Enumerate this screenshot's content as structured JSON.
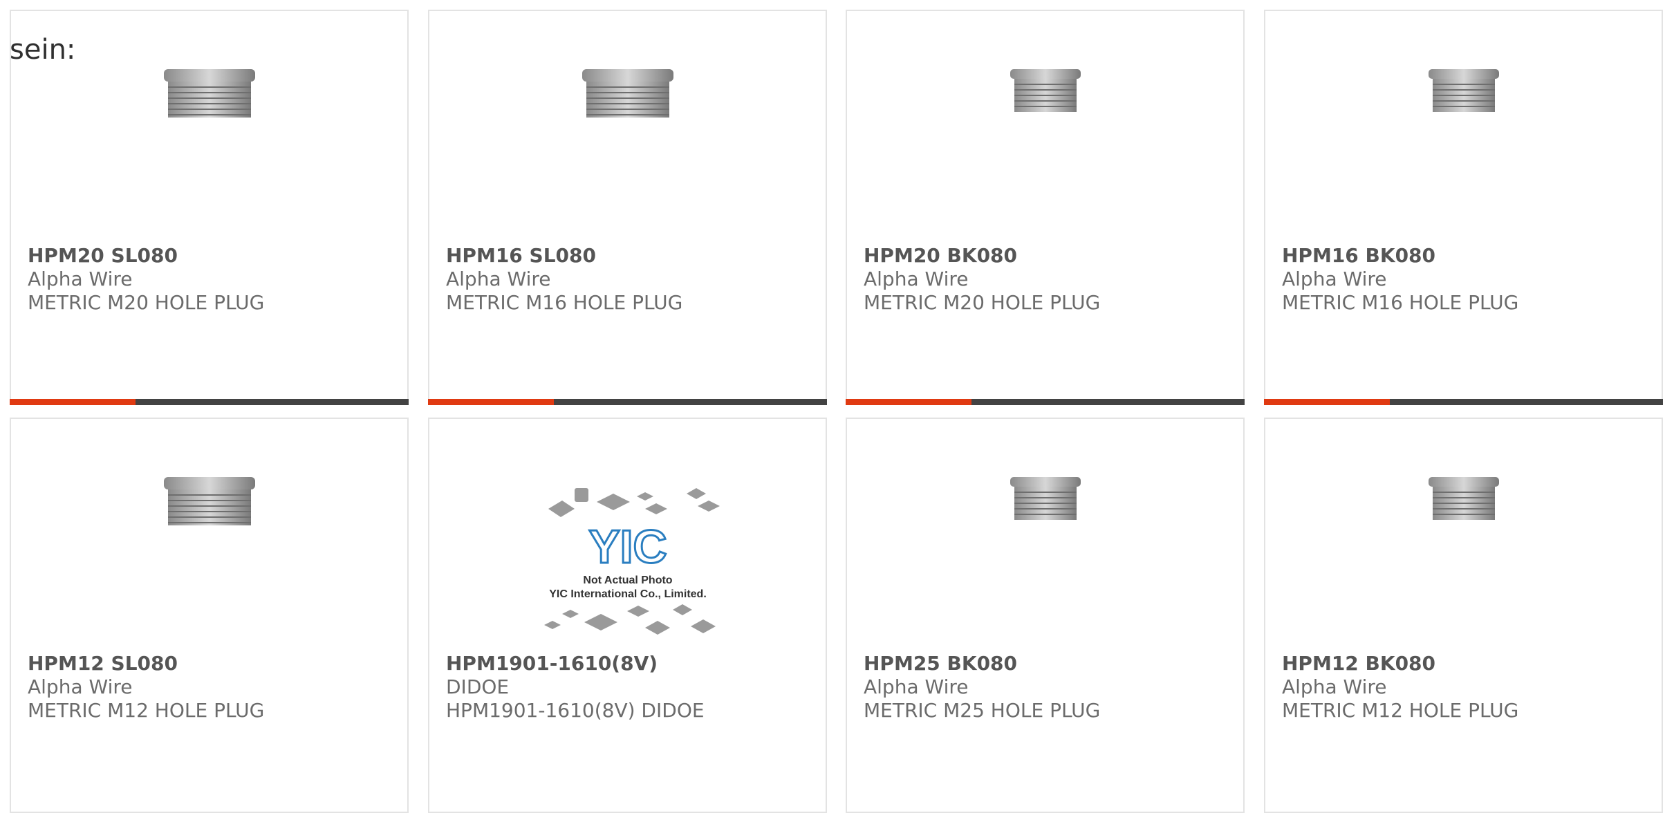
{
  "intro_text": "sein:",
  "colors": {
    "accent": "#e03a12",
    "bar": "#434343",
    "border": "#e3e3e3",
    "text_bold": "#555555",
    "text": "#6b6b6b"
  },
  "products": [
    {
      "part_number": "HPM20 SL080",
      "manufacturer": "Alpha Wire",
      "description": "METRIC M20 HOLE PLUG",
      "image": "hole-plug",
      "selected_bar": true
    },
    {
      "part_number": "HPM16 SL080",
      "manufacturer": "Alpha Wire",
      "description": "METRIC M16 HOLE PLUG",
      "image": "hole-plug",
      "selected_bar": true
    },
    {
      "part_number": "HPM20 BK080",
      "manufacturer": "Alpha Wire",
      "description": "METRIC M20 HOLE PLUG",
      "image": "hole-plug",
      "selected_bar": true
    },
    {
      "part_number": "HPM16 BK080",
      "manufacturer": "Alpha Wire",
      "description": "METRIC M16 HOLE PLUG",
      "image": "hole-plug",
      "selected_bar": true
    },
    {
      "part_number": "HPM12 SL080",
      "manufacturer": "Alpha Wire",
      "description": "METRIC M12 HOLE PLUG",
      "image": "hole-plug",
      "selected_bar": false
    },
    {
      "part_number": "HPM1901-1610(8V)",
      "manufacturer": "DIDOE",
      "description": "HPM1901-1610(8V) DIDOE",
      "image": "placeholder",
      "selected_bar": false
    },
    {
      "part_number": "HPM25 BK080",
      "manufacturer": "Alpha Wire",
      "description": "METRIC M25 HOLE PLUG",
      "image": "hole-plug",
      "selected_bar": false
    },
    {
      "part_number": "HPM12 BK080",
      "manufacturer": "Alpha Wire",
      "description": "METRIC M12 HOLE PLUG",
      "image": "hole-plug",
      "selected_bar": false
    }
  ],
  "placeholder_image": {
    "logo_text": "YIC",
    "line1": "Not Actual Photo",
    "line2": "YIC International Co., Limited."
  }
}
